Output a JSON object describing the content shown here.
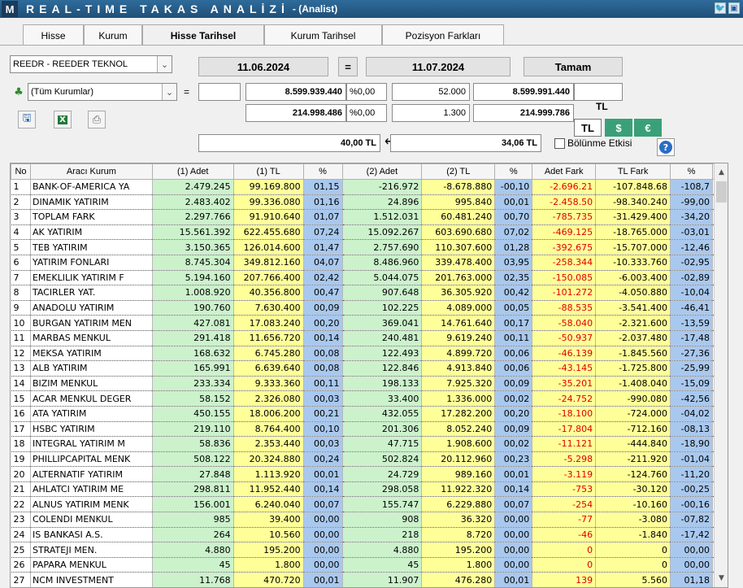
{
  "window": {
    "logo": "M",
    "title": "REAL-TIME TAKAS ANALİZİ",
    "subtitle": "- (Analist)",
    "icons": [
      "twitter-icon",
      "restore-icon"
    ]
  },
  "tabs": [
    {
      "label": "Hisse",
      "active": false
    },
    {
      "label": "Kurum",
      "active": false
    },
    {
      "label": "Hisse Tarihsel",
      "active": true
    },
    {
      "label": "Kurum Tarihsel",
      "active": false
    },
    {
      "label": "Pozisyon Farkları",
      "active": false
    }
  ],
  "controls": {
    "stock_select": "REEDR - REEDER TEKNOL",
    "date_from": "11.06.2024",
    "equals": "=",
    "date_to": "11.07.2024",
    "ok_button": "Tamam",
    "broker_select": "(Tüm Kurumlar)",
    "eq2": "=",
    "empty1": "",
    "lot1": "8.599.939.440",
    "pct1": "%0,00",
    "val1": "52.000",
    "lot2": "8.599.991.440",
    "empty2": "",
    "tl1": "214.998.486",
    "pct2": "%0,00",
    "val2": "1.300",
    "tl2": "214.999.786",
    "currency_label": "TL",
    "price1": "40,00 TL",
    "arrow": "⟷",
    "price2": "34,06 TL",
    "split_effect": "Bölünme Etkisi",
    "currency_buttons": [
      {
        "label": "TL",
        "color": "#ffffff",
        "text": "#000000"
      },
      {
        "label": "$",
        "color": "#3aa079",
        "text": "#ffffff"
      },
      {
        "label": "€",
        "color": "#3aa079",
        "text": "#ffffff"
      }
    ],
    "help": "?"
  },
  "table": {
    "headers": [
      "No",
      "Aracı Kurum",
      "(1) Adet",
      "(1) TL",
      "%",
      "(2) Adet",
      "(2) TL",
      "%",
      "Adet Fark",
      "TL Fark",
      "%"
    ],
    "rows": [
      [
        "1",
        "BANK-OF-AMERICA YA",
        "2.479.245",
        "99.169.800",
        "01,15",
        "-216.972",
        "-8.678.880",
        "-00,10",
        "-2.696.21",
        "-107.848.68",
        "-108,7"
      ],
      [
        "2",
        "DINAMIK YATIRIM",
        "2.483.402",
        "99.336.080",
        "01,16",
        "24.896",
        "995.840",
        "00,01",
        "-2.458.50",
        "-98.340.240",
        "-99,00"
      ],
      [
        "3",
        "TOPLAM FARK",
        "2.297.766",
        "91.910.640",
        "01,07",
        "1.512.031",
        "60.481.240",
        "00,70",
        "-785.735",
        "-31.429.400",
        "-34,20"
      ],
      [
        "4",
        "AK YATIRIM",
        "15.561.392",
        "622.455.680",
        "07,24",
        "15.092.267",
        "603.690.680",
        "07,02",
        "-469.125",
        "-18.765.000",
        "-03,01"
      ],
      [
        "5",
        "TEB YATIRIM",
        "3.150.365",
        "126.014.600",
        "01,47",
        "2.757.690",
        "110.307.600",
        "01,28",
        "-392.675",
        "-15.707.000",
        "-12,46"
      ],
      [
        "6",
        "YATIRIM FONLARI",
        "8.745.304",
        "349.812.160",
        "04,07",
        "8.486.960",
        "339.478.400",
        "03,95",
        "-258.344",
        "-10.333.760",
        "-02,95"
      ],
      [
        "7",
        "EMEKLILIK YATIRIM F",
        "5.194.160",
        "207.766.400",
        "02,42",
        "5.044.075",
        "201.763.000",
        "02,35",
        "-150.085",
        "-6.003.400",
        "-02,89"
      ],
      [
        "8",
        "TACIRLER YAT.",
        "1.008.920",
        "40.356.800",
        "00,47",
        "907.648",
        "36.305.920",
        "00,42",
        "-101.272",
        "-4.050.880",
        "-10,04"
      ],
      [
        "9",
        "ANADOLU YATIRIM",
        "190.760",
        "7.630.400",
        "00,09",
        "102.225",
        "4.089.000",
        "00,05",
        "-88.535",
        "-3.541.400",
        "-46,41"
      ],
      [
        "10",
        "BURGAN YATIRIM MEN",
        "427.081",
        "17.083.240",
        "00,20",
        "369.041",
        "14.761.640",
        "00,17",
        "-58.040",
        "-2.321.600",
        "-13,59"
      ],
      [
        "11",
        "MARBAS MENKUL",
        "291.418",
        "11.656.720",
        "00,14",
        "240.481",
        "9.619.240",
        "00,11",
        "-50.937",
        "-2.037.480",
        "-17,48"
      ],
      [
        "12",
        "MEKSA YATIRIM",
        "168.632",
        "6.745.280",
        "00,08",
        "122.493",
        "4.899.720",
        "00,06",
        "-46.139",
        "-1.845.560",
        "-27,36"
      ],
      [
        "13",
        "ALB YATIRIM",
        "165.991",
        "6.639.640",
        "00,08",
        "122.846",
        "4.913.840",
        "00,06",
        "-43.145",
        "-1.725.800",
        "-25,99"
      ],
      [
        "14",
        "BIZIM MENKUL",
        "233.334",
        "9.333.360",
        "00,11",
        "198.133",
        "7.925.320",
        "00,09",
        "-35.201",
        "-1.408.040",
        "-15,09"
      ],
      [
        "15",
        "ACAR MENKUL DEGER",
        "58.152",
        "2.326.080",
        "00,03",
        "33.400",
        "1.336.000",
        "00,02",
        "-24.752",
        "-990.080",
        "-42,56"
      ],
      [
        "16",
        "ATA YATIRIM",
        "450.155",
        "18.006.200",
        "00,21",
        "432.055",
        "17.282.200",
        "00,20",
        "-18.100",
        "-724.000",
        "-04,02"
      ],
      [
        "17",
        "HSBC YATIRIM",
        "219.110",
        "8.764.400",
        "00,10",
        "201.306",
        "8.052.240",
        "00,09",
        "-17.804",
        "-712.160",
        "-08,13"
      ],
      [
        "18",
        "INTEGRAL YATIRIM M",
        "58.836",
        "2.353.440",
        "00,03",
        "47.715",
        "1.908.600",
        "00,02",
        "-11.121",
        "-444.840",
        "-18,90"
      ],
      [
        "19",
        "PHILLIPCAPITAL MENK",
        "508.122",
        "20.324.880",
        "00,24",
        "502.824",
        "20.112.960",
        "00,23",
        "-5.298",
        "-211.920",
        "-01,04"
      ],
      [
        "20",
        "ALTERNATIF YATIRIM",
        "27.848",
        "1.113.920",
        "00,01",
        "24.729",
        "989.160",
        "00,01",
        "-3.119",
        "-124.760",
        "-11,20"
      ],
      [
        "21",
        "AHLATCI YATIRIM ME",
        "298.811",
        "11.952.440",
        "00,14",
        "298.058",
        "11.922.320",
        "00,14",
        "-753",
        "-30.120",
        "-00,25"
      ],
      [
        "22",
        "ALNUS YATIRIM MENK",
        "156.001",
        "6.240.040",
        "00,07",
        "155.747",
        "6.229.880",
        "00,07",
        "-254",
        "-10.160",
        "-00,16"
      ],
      [
        "23",
        "COLENDI MENKUL",
        "985",
        "39.400",
        "00,00",
        "908",
        "36.320",
        "00,00",
        "-77",
        "-3.080",
        "-07,82"
      ],
      [
        "24",
        "IS BANKASI A.S.",
        "264",
        "10.560",
        "00,00",
        "218",
        "8.720",
        "00,00",
        "-46",
        "-1.840",
        "-17,42"
      ],
      [
        "25",
        "STRATEJI MEN.",
        "4.880",
        "195.200",
        "00,00",
        "4.880",
        "195.200",
        "00,00",
        "0",
        "0",
        "00,00"
      ],
      [
        "26",
        "PAPARA MENKUL",
        "45",
        "1.800",
        "00,00",
        "45",
        "1.800",
        "00,00",
        "0",
        "0",
        "00,00"
      ],
      [
        "27",
        "NCM INVESTMENT",
        "11.768",
        "470.720",
        "00,01",
        "11.907",
        "476.280",
        "00,01",
        "139",
        "5.560",
        "01,18"
      ]
    ]
  }
}
